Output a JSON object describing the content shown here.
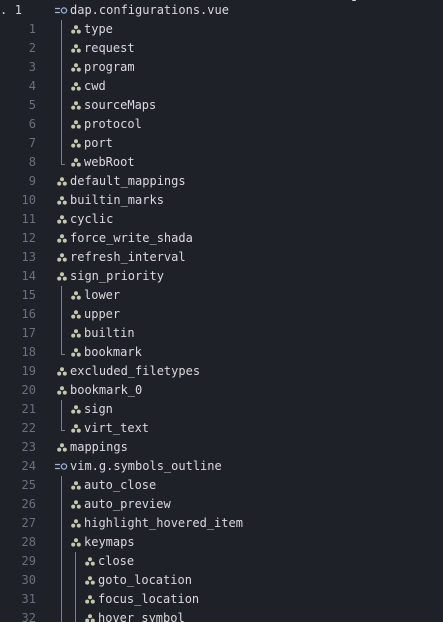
{
  "colors": {
    "background": "#1e2127",
    "line_number": "#6b717a",
    "text": "#d8dade",
    "icon": "#c5c8b0",
    "guide": "#7b8089"
  },
  "gutter_marker": ".",
  "root": {
    "line": "1",
    "label": "dap.configurations.vue",
    "icon": "mapping-icon"
  },
  "rows": [
    {
      "line": "1",
      "depth": 1,
      "label": "type",
      "icon": "node-icon",
      "guide": "branch"
    },
    {
      "line": "2",
      "depth": 1,
      "label": "request",
      "icon": "node-icon",
      "guide": "branch"
    },
    {
      "line": "3",
      "depth": 1,
      "label": "program",
      "icon": "node-icon",
      "guide": "branch"
    },
    {
      "line": "4",
      "depth": 1,
      "label": "cwd",
      "icon": "node-icon",
      "guide": "branch"
    },
    {
      "line": "5",
      "depth": 1,
      "label": "sourceMaps",
      "icon": "node-icon",
      "guide": "branch"
    },
    {
      "line": "6",
      "depth": 1,
      "label": "protocol",
      "icon": "node-icon",
      "guide": "branch"
    },
    {
      "line": "7",
      "depth": 1,
      "label": "port",
      "icon": "node-icon",
      "guide": "branch"
    },
    {
      "line": "8",
      "depth": 1,
      "label": "webRoot",
      "icon": "node-icon",
      "guide": "last"
    },
    {
      "line": "9",
      "depth": 0,
      "label": "default_mappings",
      "icon": "node-icon",
      "guide": "none"
    },
    {
      "line": "10",
      "depth": 0,
      "label": "builtin_marks",
      "icon": "node-icon",
      "guide": "none"
    },
    {
      "line": "11",
      "depth": 0,
      "label": "cyclic",
      "icon": "node-icon",
      "guide": "none"
    },
    {
      "line": "12",
      "depth": 0,
      "label": "force_write_shada",
      "icon": "node-icon",
      "guide": "none"
    },
    {
      "line": "13",
      "depth": 0,
      "label": "refresh_interval",
      "icon": "node-icon",
      "guide": "none"
    },
    {
      "line": "14",
      "depth": 0,
      "label": "sign_priority",
      "icon": "node-icon",
      "guide": "none"
    },
    {
      "line": "15",
      "depth": 1,
      "label": "lower",
      "icon": "node-icon",
      "guide": "branch"
    },
    {
      "line": "16",
      "depth": 1,
      "label": "upper",
      "icon": "node-icon",
      "guide": "branch"
    },
    {
      "line": "17",
      "depth": 1,
      "label": "builtin",
      "icon": "node-icon",
      "guide": "branch"
    },
    {
      "line": "18",
      "depth": 1,
      "label": "bookmark",
      "icon": "node-icon",
      "guide": "last"
    },
    {
      "line": "19",
      "depth": 0,
      "label": "excluded_filetypes",
      "icon": "node-icon",
      "guide": "none"
    },
    {
      "line": "20",
      "depth": 0,
      "label": "bookmark_0",
      "icon": "node-icon",
      "guide": "none"
    },
    {
      "line": "21",
      "depth": 1,
      "label": "sign",
      "icon": "node-icon",
      "guide": "branch"
    },
    {
      "line": "22",
      "depth": 1,
      "label": "virt_text",
      "icon": "node-icon",
      "guide": "last"
    },
    {
      "line": "23",
      "depth": 0,
      "label": "mappings",
      "icon": "node-icon",
      "guide": "none"
    },
    {
      "line": "24",
      "depth": 0,
      "label": "vim.g.symbols_outline",
      "icon": "mapping-icon",
      "guide": "none"
    },
    {
      "line": "25",
      "depth": 1,
      "label": "auto_close",
      "icon": "node-icon",
      "guide": "branch"
    },
    {
      "line": "26",
      "depth": 1,
      "label": "auto_preview",
      "icon": "node-icon",
      "guide": "branch"
    },
    {
      "line": "27",
      "depth": 1,
      "label": "highlight_hovered_item",
      "icon": "node-icon",
      "guide": "branch"
    },
    {
      "line": "28",
      "depth": 1,
      "label": "keymaps",
      "icon": "node-icon",
      "guide": "branch"
    },
    {
      "line": "29",
      "depth": 2,
      "label": "close",
      "icon": "node-icon",
      "guide": "branch"
    },
    {
      "line": "30",
      "depth": 2,
      "label": "goto_location",
      "icon": "node-icon",
      "guide": "branch"
    },
    {
      "line": "31",
      "depth": 2,
      "label": "focus_location",
      "icon": "node-icon",
      "guide": "branch"
    },
    {
      "line": "32",
      "depth": 2,
      "label": "hover_symbol",
      "icon": "node-icon",
      "guide": "branch"
    }
  ]
}
